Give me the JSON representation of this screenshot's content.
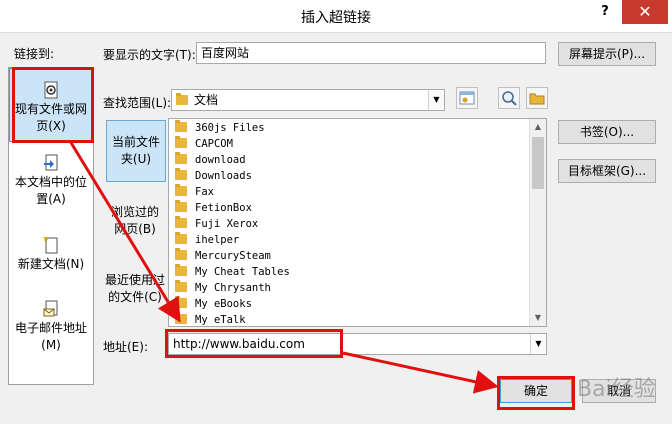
{
  "window": {
    "title": "插入超链接",
    "help_label": "?",
    "close_label": "✕"
  },
  "link_to": {
    "label": "链接到:",
    "items": [
      {
        "label_line1": "现有文件或网",
        "label_line2": "页(X)",
        "icon": "globe-document-icon"
      },
      {
        "label_line1": "本文档中的位",
        "label_line2": "置(A)",
        "icon": "document-anchor-icon"
      },
      {
        "label_line1": "新建文档(N)",
        "label_line2": "",
        "icon": "new-document-icon"
      },
      {
        "label_line1": "电子邮件地址",
        "label_line2": "(M)",
        "icon": "email-icon"
      }
    ]
  },
  "display_text": {
    "label": "要显示的文字(T):",
    "value": "百度网站"
  },
  "screentip_button": "屏幕提示(P)...",
  "look_in": {
    "label": "查找范围(L):",
    "value": "文档",
    "folder_icon": "folder-icon"
  },
  "toolbar_icons": [
    "browse-web-icon",
    "search-globe-icon",
    "browse-folder-icon"
  ],
  "side_panel": [
    {
      "label_line1": "当前文件",
      "label_line2": "夹(U)"
    },
    {
      "label_line1": "浏览过的",
      "label_line2": "网页(B)"
    },
    {
      "label_line1": "最近使用过",
      "label_line2": "的文件(C)"
    }
  ],
  "files": [
    "360js Files",
    "CAPCOM",
    "download",
    "Downloads",
    "Fax",
    "FetionBox",
    "Fuji Xerox",
    "ihelper",
    "MercurySteam",
    "My Cheat Tables",
    "My Chrysanth",
    "My eBooks",
    "My eTalk"
  ],
  "bookmark_button": "书签(O)...",
  "target_frame_button": "目标框架(G)...",
  "address": {
    "label": "地址(E):",
    "value": "http://www.baidu.com"
  },
  "ok_button": "确定",
  "cancel_button": "取消",
  "watermark": "Bai经验",
  "colors": {
    "accent_red": "#e01010",
    "selection_blue": "#cce4f7",
    "folder_yellow": "#e8b73a",
    "close_red": "#c7392d"
  }
}
